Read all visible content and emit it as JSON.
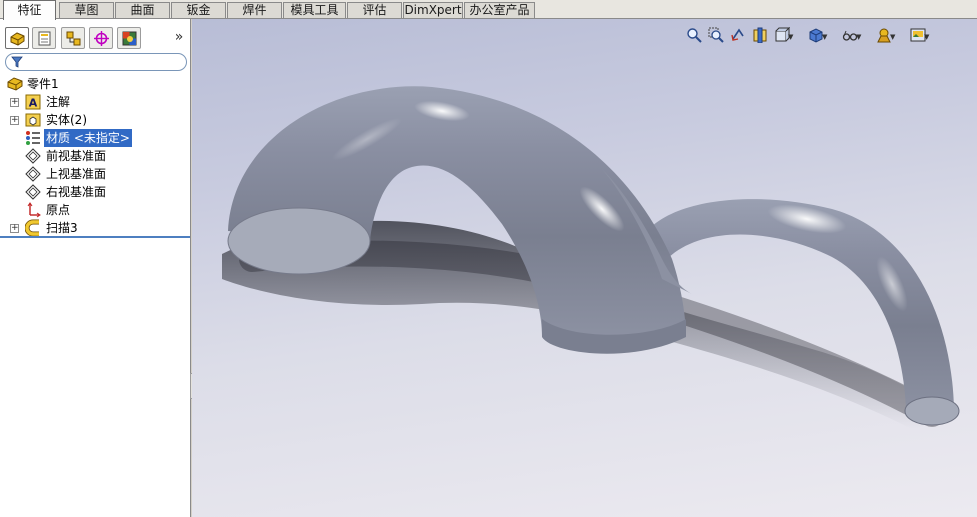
{
  "tabs": [
    {
      "label": "特征",
      "active": true
    },
    {
      "label": "草图"
    },
    {
      "label": "曲面"
    },
    {
      "label": "钣金"
    },
    {
      "label": "焊件"
    },
    {
      "label": "模具工具"
    },
    {
      "label": "评估"
    },
    {
      "label": "DimXpert"
    },
    {
      "label": "办公室产品"
    }
  ],
  "panel": {
    "collapse_glyph": "»",
    "panel_tabs": [
      {
        "icon": "feature-manager-icon",
        "active": true
      },
      {
        "icon": "property-manager-icon"
      },
      {
        "icon": "configuration-manager-icon"
      },
      {
        "icon": "dimxpert-manager-icon"
      },
      {
        "icon": "display-manager-icon"
      }
    ],
    "filter_icon": "filter-icon"
  },
  "tree": {
    "part": "零件1",
    "annotations": "注解",
    "solid_bodies": "实体(2)",
    "material": "材质 <未指定>",
    "front_plane": "前视基准面",
    "top_plane": "上视基准面",
    "right_plane": "右视基准面",
    "origin": "原点",
    "sweep": "扫描3"
  },
  "viewtools": [
    "zoom-to-fit-icon",
    "zoom-to-area-icon",
    "previous-view-icon",
    "section-view-icon",
    "view-orientation-icon",
    "display-style-icon",
    "hide-show-items-icon",
    "edit-appearance-icon",
    "apply-scene-icon"
  ],
  "colors": {
    "selection": "#316ac5",
    "model_surface": "#8a8fa0",
    "viewport_top": "#b8bdd6",
    "viewport_bottom": "#eceaf0"
  }
}
